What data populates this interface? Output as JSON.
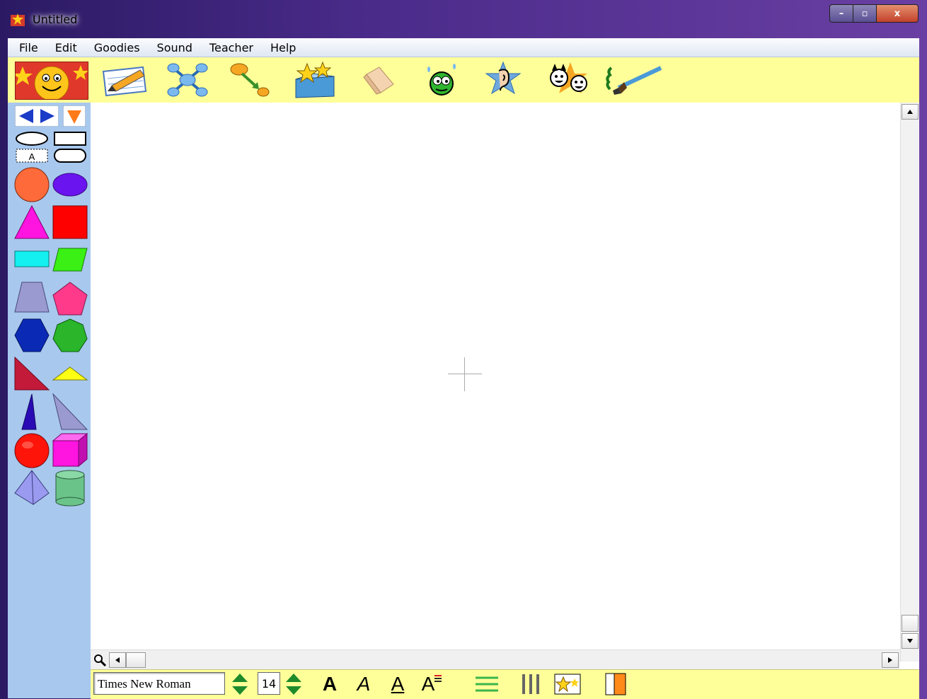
{
  "window": {
    "title": "Untitled",
    "minimize": "–",
    "maximize": "▫",
    "close": "x"
  },
  "menu": [
    "File",
    "Edit",
    "Goodies",
    "Sound",
    "Teacher",
    "Help"
  ],
  "toolbar": {
    "tools": [
      "pencil-paper-icon",
      "concept-map-icon",
      "link-arrow-icon",
      "star-box-icon",
      "eraser-icon",
      "bug-face-icon",
      "ear-star-icon",
      "faces-star-icon",
      "paintbrush-icon"
    ]
  },
  "bottombar": {
    "font_name": "Times New Roman",
    "font_size": "14",
    "bold": "A",
    "italic": "A",
    "underline": "A",
    "superscript": "A"
  },
  "colors": {
    "toolbar_bg": "#ffff99",
    "palette_bg": "#a8c8ee",
    "accent_blue": "#1a3cc7",
    "accent_orange": "#ff7a1a"
  }
}
